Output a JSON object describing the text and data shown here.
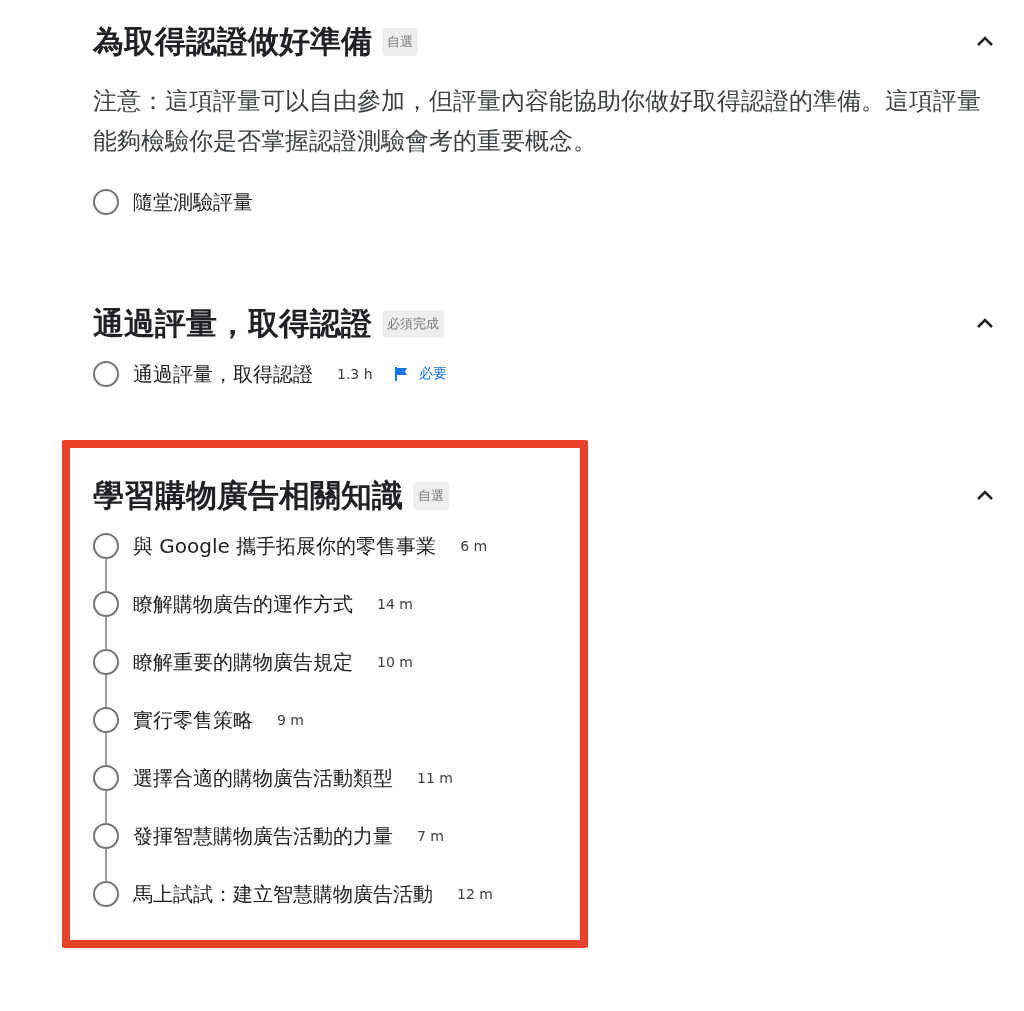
{
  "sections": [
    {
      "title": "為取得認證做好準備",
      "tag": "自選",
      "expanded": true,
      "description": "注意：這項評量可以自由參加，但評量內容能協助你做好取得認證的準備。這項評量能夠檢驗你是否掌握認證測驗會考的重要概念。",
      "items": [
        {
          "title": "隨堂測驗評量",
          "completed": false
        }
      ]
    },
    {
      "title": "通過評量，取得認證",
      "tag": "必須完成",
      "expanded": true,
      "items": [
        {
          "title": "通過評量，取得認證",
          "duration": "1.3 h",
          "required": "必要",
          "completed": false
        }
      ]
    },
    {
      "title": "學習購物廣告相關知識",
      "tag": "自選",
      "expanded": true,
      "highlighted": true,
      "connected": true,
      "items": [
        {
          "title": "與 Google 攜手拓展你的零售事業",
          "duration": "6 m",
          "completed": false
        },
        {
          "title": "瞭解購物廣告的運作方式",
          "duration": "14 m",
          "completed": false
        },
        {
          "title": "瞭解重要的購物廣告規定",
          "duration": "10 m",
          "completed": false
        },
        {
          "title": "實行零售策略",
          "duration": "9 m",
          "completed": false
        },
        {
          "title": "選擇合適的購物廣告活動類型",
          "duration": "11 m",
          "completed": false
        },
        {
          "title": "發揮智慧購物廣告活動的力量",
          "duration": "7 m",
          "completed": false
        },
        {
          "title": "馬上試試：建立智慧購物廣告活動",
          "duration": "12 m",
          "completed": false
        }
      ]
    }
  ]
}
